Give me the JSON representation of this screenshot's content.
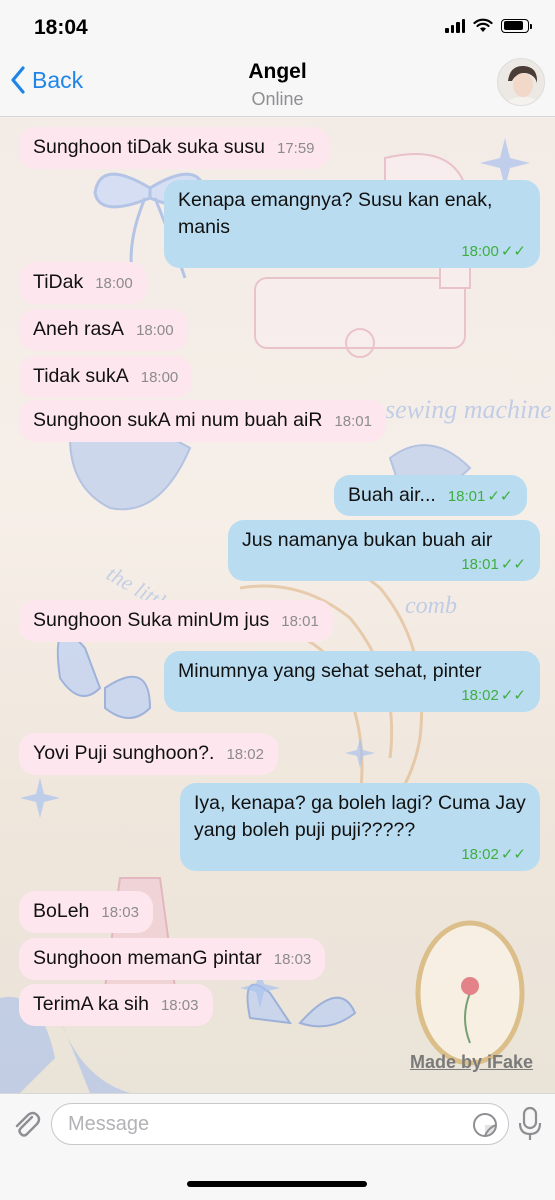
{
  "status_bar": {
    "time": "18:04",
    "battery_level": 0.85
  },
  "header": {
    "back_label": "Back",
    "contact_name": "Angel",
    "contact_status": "Online"
  },
  "messages": [
    {
      "dir": "in",
      "text": "Sunghoon tiDak suka susu",
      "time": "17:59"
    },
    {
      "dir": "out",
      "text": "Kenapa emangnya? Susu kan enak, manis",
      "time": "18:00",
      "read": true
    },
    {
      "dir": "in",
      "text": "TiDak",
      "time": "18:00"
    },
    {
      "dir": "in",
      "text": "Aneh rasA",
      "time": "18:00"
    },
    {
      "dir": "in",
      "text": "Tidak sukA",
      "time": "18:00"
    },
    {
      "dir": "in",
      "text": "Sunghoon sukA mi num buah aiR",
      "time": "18:01"
    },
    {
      "dir": "out",
      "text": "Buah air...",
      "time": "18:01",
      "read": true
    },
    {
      "dir": "out",
      "text": "Jus namanya bukan buah air",
      "time": "18:01",
      "read": true
    },
    {
      "dir": "in",
      "text": "Sunghoon Suka minUm jus",
      "time": "18:01"
    },
    {
      "dir": "out",
      "text": "Minumnya yang sehat sehat, pinter",
      "time": "18:02",
      "read": true
    },
    {
      "dir": "in",
      "text": "Yovi Puji sunghoon?.",
      "time": "18:02"
    },
    {
      "dir": "out",
      "text": "Iya, kenapa? ga boleh lagi? Cuma Jay yang boleh puji puji?????",
      "time": "18:02",
      "read": true
    },
    {
      "dir": "in",
      "text": "BoLeh",
      "time": "18:03"
    },
    {
      "dir": "in",
      "text": "Sunghoon memanG pintar",
      "time": "18:03"
    },
    {
      "dir": "in",
      "text": "TerimA ka sih",
      "time": "18:03"
    }
  ],
  "watermark": "Made by iFake",
  "input": {
    "placeholder": "Message"
  },
  "icons": {
    "back": "chevron-left-icon",
    "attach": "paperclip-icon",
    "sticker": "sticker-icon",
    "mic": "microphone-icon",
    "read_receipt": "double-check-icon"
  },
  "colors": {
    "accent": "#1f86e8",
    "incoming_bubble": "#fde6ee",
    "outgoing_bubble": "#b9dcf1",
    "read_check": "#3fae3f"
  }
}
